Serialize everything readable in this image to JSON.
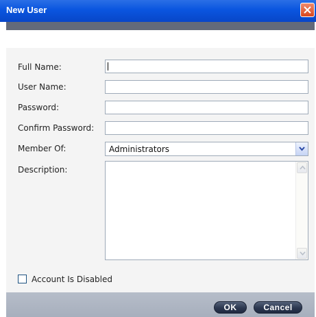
{
  "window": {
    "title": "New User"
  },
  "form": {
    "full_name_label": "Full Name:",
    "full_name_value": "",
    "user_name_label": "User Name:",
    "user_name_value": "",
    "password_label": "Password:",
    "password_value": "",
    "confirm_password_label": "Confirm Password:",
    "confirm_password_value": "",
    "member_of_label": "Member Of:",
    "member_of_value": "Administrators",
    "description_label": "Description:",
    "description_value": "",
    "account_disabled_label": "Account Is Disabled",
    "account_disabled_checked": false
  },
  "buttons": {
    "ok": "OK",
    "cancel": "Cancel"
  },
  "colors": {
    "titlebar": "#0a55df",
    "close_button": "#d8471e",
    "footer": "#b0b7c4",
    "button": "#2c3850"
  },
  "icons": [
    "close-icon",
    "chevron-down-icon",
    "scroll-up-icon",
    "scroll-down-icon"
  ]
}
